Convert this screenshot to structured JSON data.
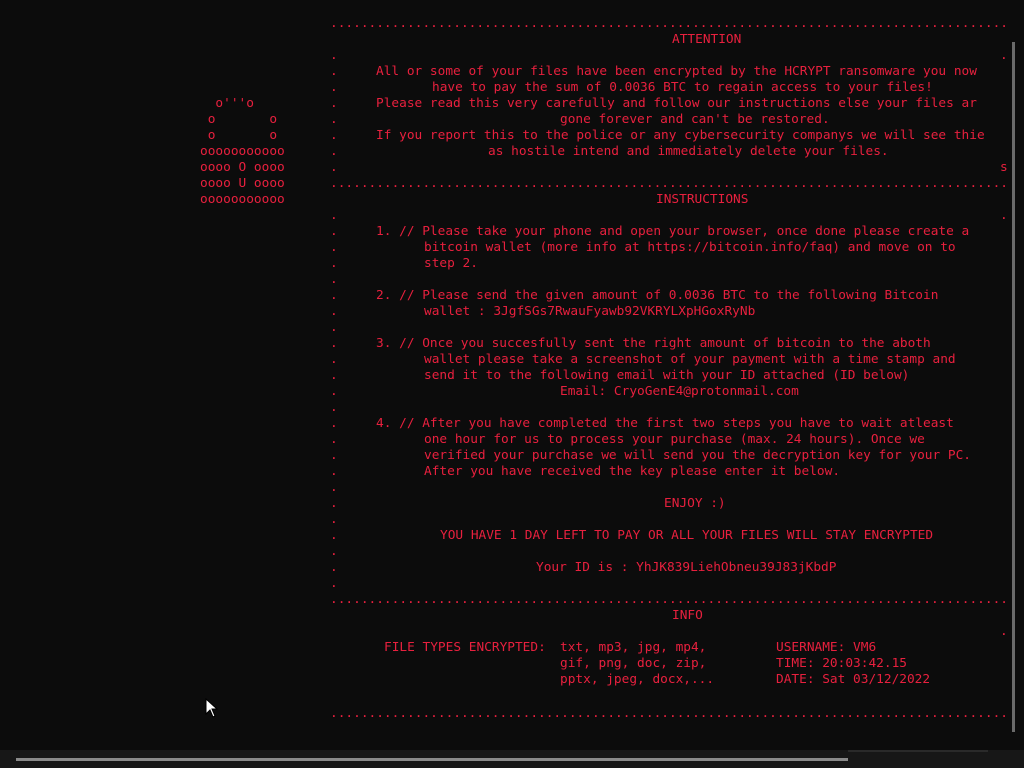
{
  "logo": [
    "  o'''o",
    " o       o",
    " o       o",
    "ooooooooooo",
    "oooo O oooo",
    "oooo U oooo",
    "ooooooooooo"
  ],
  "note": {
    "border": ".........................................................................................................",
    "attention_title": "ATTENTION",
    "attention": [
      "All or some of your files have been encrypted by the HCRYPT ransomware you now",
      "have to pay the sum of 0.0036 BTC to regain access to your files!",
      "Please read this very carefully and follow our instructions else your files ar",
      "gone forever and can't be restored.",
      "If you report this to the police or any cybersecurity companys we will see thie",
      "as hostile intend and immediately delete your files.",
      "s"
    ],
    "instructions_title": "INSTRUCTIONS",
    "step1": [
      "1. // Please take your phone and open your browser, once done please create a",
      "bitcoin wallet (more info at https://bitcoin.info/faq) and move on to",
      "step 2."
    ],
    "step2": [
      "2. // Please send the given amount of 0.0036 BTC to the following Bitcoin",
      "wallet : 3JgfSGs7RwauFyawb92VKRYLXpHGoxRyNb"
    ],
    "step3": [
      "3. // Once you succesfully sent the right amount of bitcoin to the aboth",
      "wallet please take a screenshot of your payment with a time stamp and",
      "send it to the following email with your ID attached (ID below)",
      "Email: CryoGenE4@protonmail.com"
    ],
    "step4": [
      "4. // After you have completed the first two steps you have to wait atleast",
      "one hour for us to process your purchase (max. 24 hours). Once we",
      "verified your purchase we will send you the decryption key for your PC.",
      "After you have received the key please enter it below."
    ],
    "enjoy": "ENJOY :)",
    "deadline": "YOU HAVE 1 DAY LEFT TO PAY OR ALL YOUR FILES WILL STAY ENCRYPTED",
    "your_id": "Your ID is : YhJK839LiehObneu39J83jKbdP",
    "info_title": "INFO",
    "file_types_label": "FILE TYPES ENCRYPTED:",
    "file_types": [
      "txt, mp3, jpg, mp4,",
      "gif, png, doc, zip,",
      "pptx, jpeg, docx,..."
    ],
    "username": "USERNAME: VM6",
    "time": "TIME: 20:03:42.15",
    "date": "DATE: Sat 03/12/2022"
  },
  "colors": {
    "text": "#e8203e",
    "background": "#0c0c0c"
  }
}
